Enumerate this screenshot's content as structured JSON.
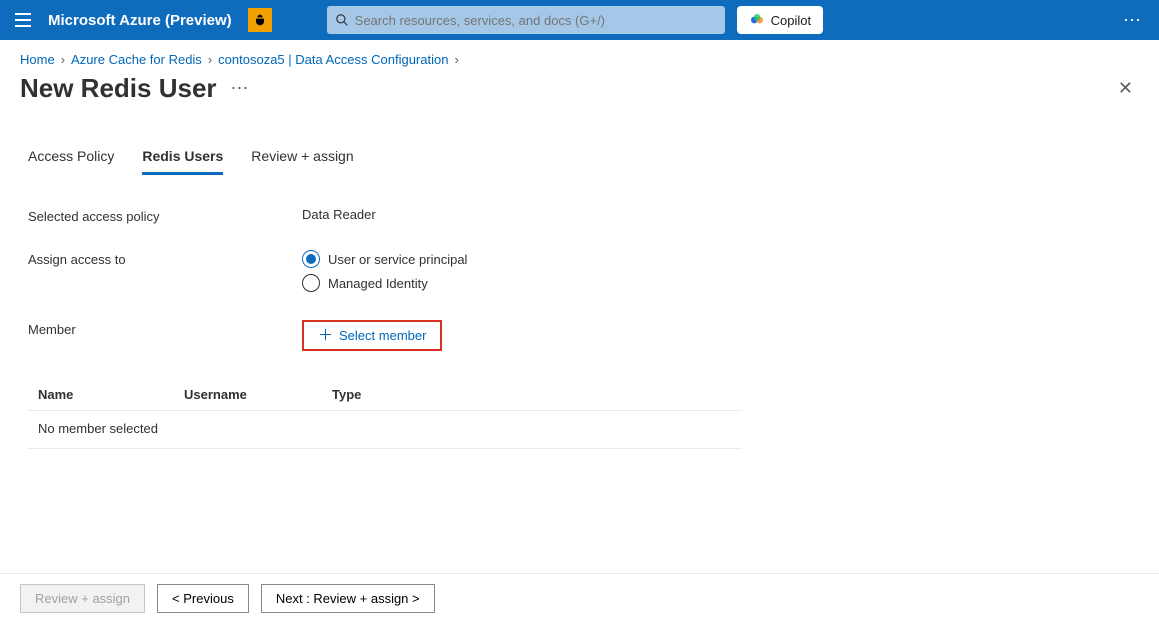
{
  "topbar": {
    "brand": "Microsoft Azure (Preview)",
    "search_placeholder": "Search resources, services, and docs (G+/)",
    "copilot_label": "Copilot"
  },
  "breadcrumb": {
    "items": [
      "Home",
      "Azure Cache for Redis",
      "contosoza5 | Data Access Configuration"
    ]
  },
  "page": {
    "title": "New Redis User"
  },
  "tabs": [
    {
      "label": "Access Policy",
      "active": false
    },
    {
      "label": "Redis Users",
      "active": true
    },
    {
      "label": "Review + assign",
      "active": false
    }
  ],
  "form": {
    "selected_policy_label": "Selected access policy",
    "selected_policy_value": "Data Reader",
    "assign_label": "Assign access to",
    "assign_options": [
      {
        "label": "User or service principal",
        "selected": true
      },
      {
        "label": "Managed Identity",
        "selected": false
      }
    ],
    "member_label": "Member",
    "select_member_btn": "Select member"
  },
  "table": {
    "columns": [
      "Name",
      "Username",
      "Type"
    ],
    "empty_text": "No member selected"
  },
  "footer": {
    "review_label": "Review + assign",
    "previous_label": "< Previous",
    "next_label": "Next : Review + assign >"
  },
  "colors": {
    "primary": "#0f6cbd",
    "highlight_border": "#d93025"
  }
}
